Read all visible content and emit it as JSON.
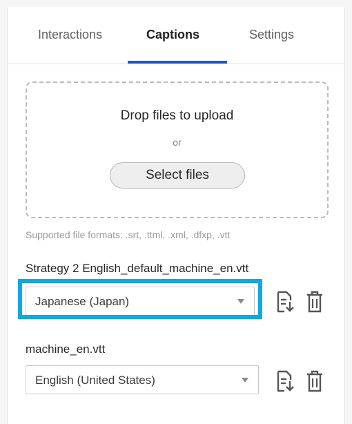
{
  "tabs": [
    {
      "label": "Interactions"
    },
    {
      "label": "Captions"
    },
    {
      "label": "Settings"
    }
  ],
  "dropzone": {
    "title": "Drop files to upload",
    "or": "or",
    "button": "Select files"
  },
  "supported_formats": "Supported file formats: .srt, .ttml, .xml, .dfxp, .vtt",
  "captions": [
    {
      "file": "Strategy 2 English_default_machine_en.vtt",
      "language": "Japanese (Japan)",
      "download_icon": "download-file-icon",
      "delete_icon": "trash-icon"
    },
    {
      "file": "machine_en.vtt",
      "language": "English (United States)",
      "download_icon": "download-file-icon",
      "delete_icon": "trash-icon"
    }
  ],
  "colors": {
    "accent": "#1a56c9",
    "highlight": "#10a8e0"
  }
}
